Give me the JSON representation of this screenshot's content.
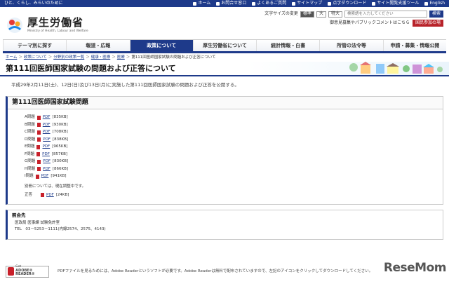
{
  "topbar": {
    "tagline": "ひと、くらし、みらいのために",
    "links": [
      "ホーム",
      "お問合せ窓口",
      "よくあるご質問",
      "サイトマップ",
      "点字ダウンロード",
      "サイト閲覧支援ツール",
      "English"
    ]
  },
  "header": {
    "logo_jp": "厚生労働省",
    "logo_en": "Ministry of Health, Labour and Welfare",
    "font_size_label": "文字サイズの変更",
    "font_sizes": [
      "標準",
      "大",
      "特大"
    ],
    "search_placeholder": "検索語を入力してください",
    "search_button": "検索",
    "links_row": "御意見募集やパブリックコメントはこちら",
    "participate_badge": "国民参加の場"
  },
  "nav": [
    "テーマ別に探す",
    "報道・広報",
    "政策について",
    "厚生労働省について",
    "統計情報・白書",
    "所管の法令等",
    "申請・募集・情報公開"
  ],
  "nav_active_index": 2,
  "breadcrumb": [
    "ホーム",
    "政策について",
    "分野別の政策一覧",
    "健康・医療",
    "医療",
    "第111回医師国家試験の問題および正答について"
  ],
  "page_title": "第111回医師国家試験の問題および正答について",
  "intro_text": "平成29年2月11日(土)、12日(日)及び13日(月)に実施した第111回医師国家試験の問題および正答を公開する。",
  "exam": {
    "heading": "第111回医師国家試験問題",
    "items": [
      {
        "label": "A問題",
        "link": "PDF",
        "size": "[835KB]"
      },
      {
        "label": "B問題",
        "link": "PDF",
        "size": "[930KB]"
      },
      {
        "label": "C問題",
        "link": "PDF",
        "size": "[708KB]"
      },
      {
        "label": "D問題",
        "link": "PDF",
        "size": "[838KB]"
      },
      {
        "label": "E問題",
        "link": "PDF",
        "size": "[965KB]"
      },
      {
        "label": "F問題",
        "link": "PDF",
        "size": "[857KB]"
      },
      {
        "label": "G問題",
        "link": "PDF",
        "size": "[830KB]"
      },
      {
        "label": "H問題",
        "link": "PDF",
        "size": "[866KB]"
      },
      {
        "label": "I問題",
        "link": "PDF",
        "size": "[941KB]"
      }
    ],
    "note": "別冊については、現在調整中です。",
    "answer_label": "正答",
    "answer_link": "PDF",
    "answer_size": "[24KB]"
  },
  "contact": {
    "heading": "照会先",
    "dept": "医政局 医事課 試験免許室",
    "tel": "TEL　03－5253－1111(内線2574、2575、4143)"
  },
  "footer": {
    "adobe_small": "Get",
    "adobe_name": "ADOBE® READER®",
    "text": "PDFファイルを見るためには、Adobe Readerというソフトが必要です。Adobe Readerは無料で配布されていますので、左記のアイコンをクリックしてダウンロードしてください。"
  },
  "watermark": "ReseMom",
  "watermark_small": "リセマム"
}
